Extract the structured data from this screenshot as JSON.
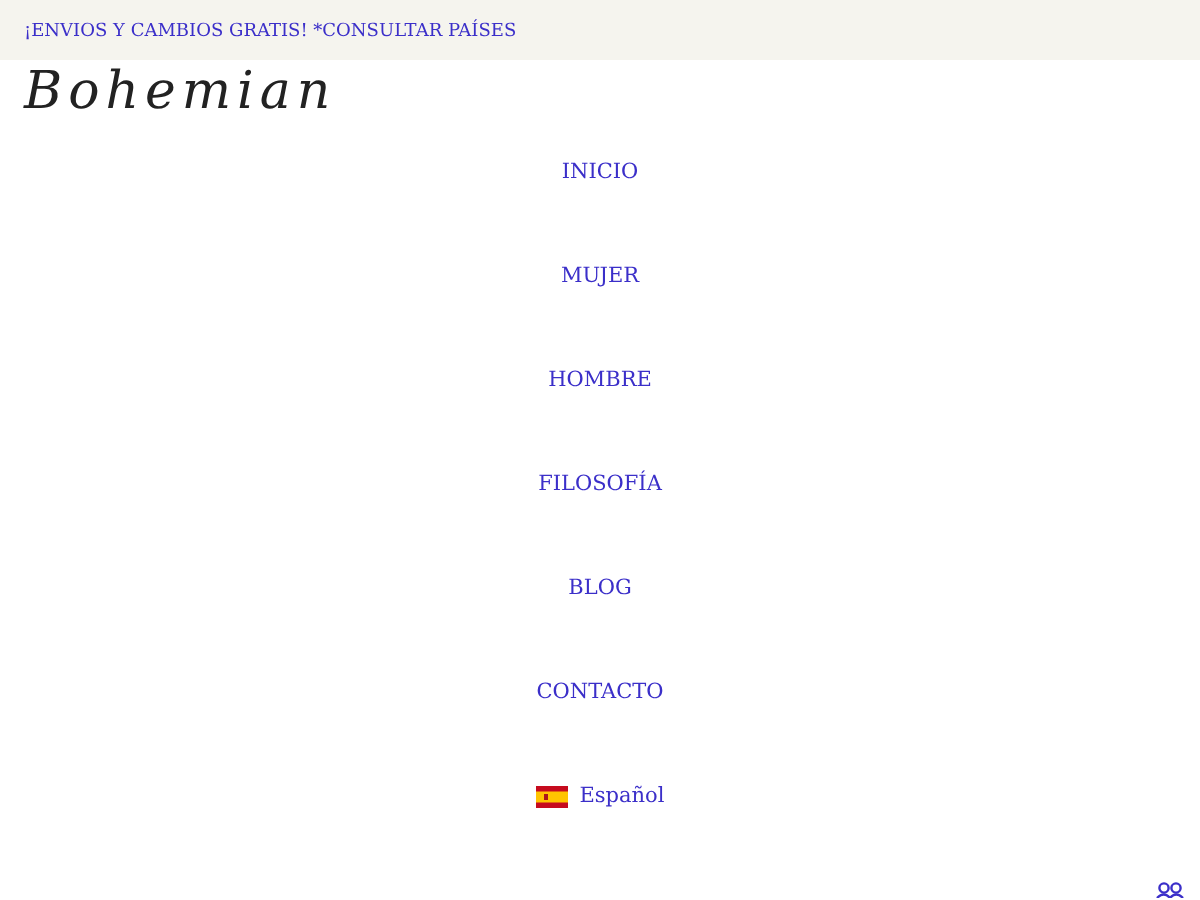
{
  "announcement": "¡ENVIOS Y CAMBIOS GRATIS! *CONSULTAR PAÍSES",
  "logo": "Bohemian",
  "nav": [
    {
      "label": "INICIO"
    },
    {
      "label": "MUJER"
    },
    {
      "label": "HOMBRE"
    },
    {
      "label": "FILOSOFÍA"
    },
    {
      "label": "BLOG"
    },
    {
      "label": "CONTACTO"
    }
  ],
  "language": {
    "label": "Español"
  }
}
